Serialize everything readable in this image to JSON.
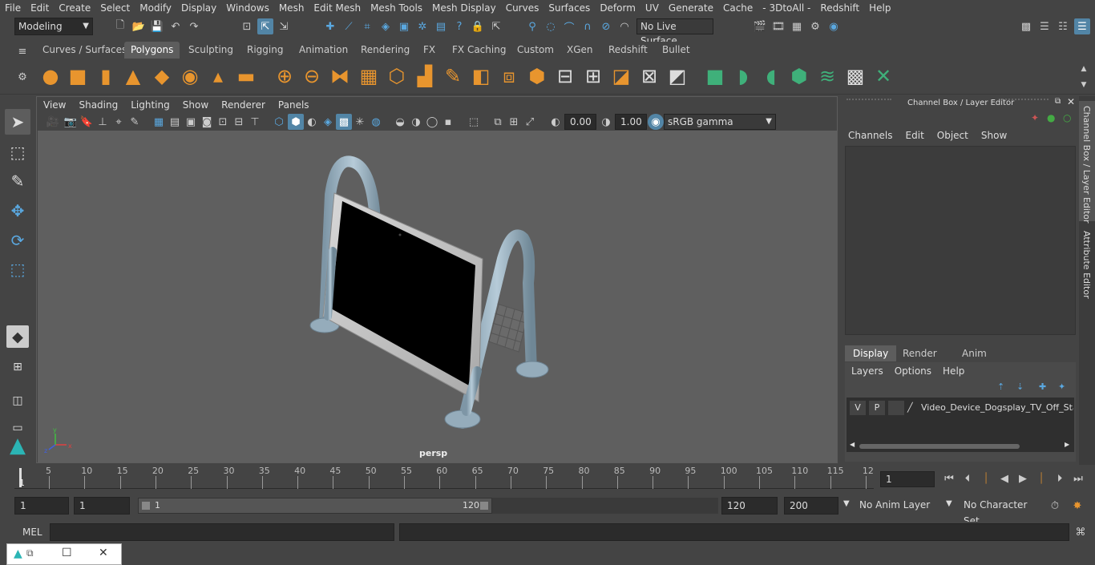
{
  "menubar": {
    "items": [
      "File",
      "Edit",
      "Create",
      "Select",
      "Modify",
      "Display",
      "Windows",
      "Mesh",
      "Edit Mesh",
      "Mesh Tools",
      "Mesh Display",
      "Curves",
      "Surfaces",
      "Deform",
      "UV",
      "Generate",
      "Cache",
      "- 3DtoAll -",
      "Redshift",
      "Help"
    ]
  },
  "statusline": {
    "mode": "Modeling",
    "live_surface": "No Live Surface"
  },
  "shelf": {
    "tabs": [
      "Curves / Surfaces",
      "Polygons",
      "Sculpting",
      "Rigging",
      "Animation",
      "Rendering",
      "FX",
      "FX Caching",
      "Custom",
      "XGen",
      "Redshift",
      "Bullet"
    ],
    "active_tab": "Polygons"
  },
  "viewport": {
    "menu": [
      "View",
      "Shading",
      "Lighting",
      "Show",
      "Renderer",
      "Panels"
    ],
    "exposure": "0.00",
    "gamma": "1.00",
    "color_space": "sRGB gamma",
    "camera_label": "persp"
  },
  "channel_box": {
    "title": "Channel Box / Layer Editor",
    "menu": [
      "Channels",
      "Edit",
      "Object",
      "Show"
    ],
    "layer_tabs": [
      "Display",
      "Render",
      "Anim"
    ],
    "active_layer_tab": "Display",
    "layer_menu": [
      "Layers",
      "Options",
      "Help"
    ],
    "layer": {
      "v": "V",
      "p": "P",
      "name": "Video_Device_Dogsplay_TV_Off_State"
    }
  },
  "side_tabs": {
    "channel": "Channel Box / Layer Editor",
    "attribute": "Attribute Editor"
  },
  "timeline": {
    "ticks": [
      "5",
      "10",
      "15",
      "20",
      "25",
      "30",
      "35",
      "40",
      "45",
      "50",
      "55",
      "60",
      "65",
      "70",
      "75",
      "80",
      "85",
      "90",
      "95",
      "100",
      "105",
      "110",
      "115",
      "12"
    ],
    "start_marker": "1",
    "current_frame": "1"
  },
  "range": {
    "start": "1",
    "anim_start": "1",
    "slider_start": "1",
    "slider_end": "120",
    "end": "120",
    "anim_end": "200",
    "anim_layer": "No Anim Layer",
    "character_set": "No Character Set"
  },
  "cmdline": {
    "label": "MEL"
  },
  "colors": {
    "accent": "#5285a6",
    "shelf_orange": "#e8952e",
    "shelf_green": "#3fb07a",
    "viewport_bg": "#5f5f5f"
  }
}
